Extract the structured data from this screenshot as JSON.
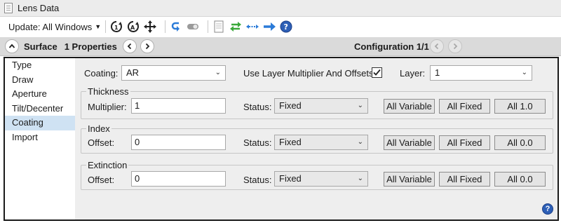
{
  "window": {
    "title": "Lens Data"
  },
  "toolbar": {
    "update_label": "Update: All Windows",
    "icons": [
      "calc-1-icon",
      "calc-all-icon",
      "crosshair-icon",
      "undo-arrow-icon",
      "toggle-icon",
      "page-icon",
      "swap-arrows-icon",
      "expand-arrows-icon",
      "right-arrow-icon",
      "help-icon"
    ]
  },
  "header": {
    "section": "Surface",
    "properties": "1 Properties",
    "configuration": "Configuration 1/1"
  },
  "sidebar": {
    "items": [
      {
        "label": "Type"
      },
      {
        "label": "Draw"
      },
      {
        "label": "Aperture"
      },
      {
        "label": "Tilt/Decenter"
      },
      {
        "label": "Coating"
      },
      {
        "label": "Import"
      }
    ],
    "active": "Coating"
  },
  "coating": {
    "label": "Coating:",
    "value": "AR",
    "use_layer_label": "Use Layer Multiplier And Offsets:",
    "use_layer_checked": true,
    "layer_label": "Layer:",
    "layer_value": "1"
  },
  "groups": {
    "thickness": {
      "title": "Thickness",
      "field_label": "Multiplier:",
      "field_value": "1",
      "status_label": "Status:",
      "status_value": "Fixed",
      "btn_variable": "All Variable",
      "btn_fixed": "All Fixed",
      "btn_value": "All 1.0"
    },
    "index": {
      "title": "Index",
      "field_label": "Offset:",
      "field_value": "0",
      "status_label": "Status:",
      "status_value": "Fixed",
      "btn_variable": "All Variable",
      "btn_fixed": "All Fixed",
      "btn_value": "All 0.0"
    },
    "extinction": {
      "title": "Extinction",
      "field_label": "Offset:",
      "field_value": "0",
      "status_label": "Status:",
      "status_value": "Fixed",
      "btn_variable": "All Variable",
      "btn_fixed": "All Fixed",
      "btn_value": "All 0.0"
    }
  },
  "colors": {
    "accent": "#2b7bd8",
    "active_row": "#cfe2f3",
    "panel_bg": "#eeeeee"
  }
}
